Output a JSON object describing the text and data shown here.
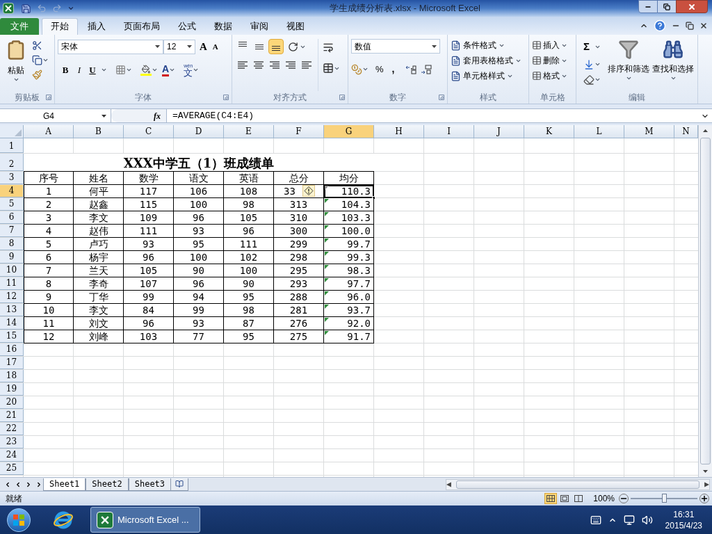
{
  "window": {
    "title": "学生成绩分析表.xlsx - Microsoft Excel"
  },
  "ribbon_tabs": [
    {
      "label": "文件",
      "kind": "file",
      "selected": false
    },
    {
      "label": "开始",
      "kind": "tab",
      "selected": true
    },
    {
      "label": "插入",
      "kind": "tab",
      "selected": false
    },
    {
      "label": "页面布局",
      "kind": "tab",
      "selected": false
    },
    {
      "label": "公式",
      "kind": "tab",
      "selected": false
    },
    {
      "label": "数据",
      "kind": "tab",
      "selected": false
    },
    {
      "label": "审阅",
      "kind": "tab",
      "selected": false
    },
    {
      "label": "视图",
      "kind": "tab",
      "selected": false
    }
  ],
  "ribbon": {
    "clipboard": {
      "label": "剪贴板",
      "paste": "粘贴"
    },
    "font": {
      "label": "字体",
      "name": "宋体",
      "size": "12",
      "grow": "A",
      "shrink": "A",
      "bold": "B",
      "italic": "I",
      "underline": "U",
      "font_color": "A",
      "phonetic_hint": "wén",
      "phonetic": "文"
    },
    "alignment": {
      "label": "对齐方式",
      "vertical": [
        {
          "selected": false
        },
        {
          "selected": false
        },
        {
          "selected": true
        }
      ]
    },
    "number": {
      "label": "数字",
      "format": "数值",
      "percent": "%",
      "comma": ","
    },
    "styles": {
      "label": "样式",
      "items": [
        "条件格式",
        "套用表格格式",
        "单元格样式"
      ]
    },
    "cells": {
      "label": "单元格",
      "items": [
        "插入",
        "删除",
        "格式"
      ]
    },
    "editing": {
      "label": "编辑",
      "sum": "Σ",
      "sort": "排序和筛选",
      "find": "查找和选择"
    }
  },
  "formula_bar": {
    "name_box": "G4",
    "fx": "fx",
    "formula": "=AVERAGE(C4:E4)"
  },
  "columns": [
    {
      "label": "A",
      "selected": false
    },
    {
      "label": "B",
      "selected": false
    },
    {
      "label": "C",
      "selected": false
    },
    {
      "label": "D",
      "selected": false
    },
    {
      "label": "E",
      "selected": false
    },
    {
      "label": "F",
      "selected": false
    },
    {
      "label": "G",
      "selected": true
    },
    {
      "label": "H",
      "selected": false
    },
    {
      "label": "I",
      "selected": false
    },
    {
      "label": "J",
      "selected": false
    },
    {
      "label": "K",
      "selected": false
    },
    {
      "label": "L",
      "selected": false
    },
    {
      "label": "M",
      "selected": false
    },
    {
      "label": "N",
      "selected": false
    }
  ],
  "rows": [
    {
      "number": "1",
      "kind": "blank",
      "selected": false
    },
    {
      "number": "2",
      "kind": "title",
      "selected": false,
      "title": "XXX中学五（1）班成绩单"
    },
    {
      "number": "3",
      "kind": "header",
      "selected": false,
      "cells": [
        "序号",
        "姓名",
        "数学",
        "语文",
        "英语",
        "总分",
        "均分"
      ]
    },
    {
      "number": "4",
      "kind": "data",
      "selected": true,
      "flag": true,
      "smart_tag": true,
      "cells": [
        "1",
        "何平",
        "117",
        "106",
        "108",
        "33",
        "110.3"
      ]
    },
    {
      "number": "5",
      "kind": "data",
      "selected": false,
      "flag": true,
      "cells": [
        "2",
        "赵鑫",
        "115",
        "100",
        "98",
        "313",
        "104.3"
      ]
    },
    {
      "number": "6",
      "kind": "data",
      "selected": false,
      "flag": true,
      "cells": [
        "3",
        "李文",
        "109",
        "96",
        "105",
        "310",
        "103.3"
      ]
    },
    {
      "number": "7",
      "kind": "data",
      "selected": false,
      "flag": true,
      "cells": [
        "4",
        "赵伟",
        "111",
        "93",
        "96",
        "300",
        "100.0"
      ]
    },
    {
      "number": "8",
      "kind": "data",
      "selected": false,
      "flag": true,
      "cells": [
        "5",
        "卢巧",
        "93",
        "95",
        "111",
        "299",
        "99.7"
      ]
    },
    {
      "number": "9",
      "kind": "data",
      "selected": false,
      "flag": true,
      "cells": [
        "6",
        "杨宇",
        "96",
        "100",
        "102",
        "298",
        "99.3"
      ]
    },
    {
      "number": "10",
      "kind": "data",
      "selected": false,
      "flag": true,
      "cells": [
        "7",
        "兰天",
        "105",
        "90",
        "100",
        "295",
        "98.3"
      ]
    },
    {
      "number": "11",
      "kind": "data",
      "selected": false,
      "flag": true,
      "cells": [
        "8",
        "李奇",
        "107",
        "96",
        "90",
        "293",
        "97.7"
      ]
    },
    {
      "number": "12",
      "kind": "data",
      "selected": false,
      "flag": true,
      "cells": [
        "9",
        "丁华",
        "99",
        "94",
        "95",
        "288",
        "96.0"
      ]
    },
    {
      "number": "13",
      "kind": "data",
      "selected": false,
      "flag": true,
      "cells": [
        "10",
        "李文",
        "84",
        "99",
        "98",
        "281",
        "93.7"
      ]
    },
    {
      "number": "14",
      "kind": "data",
      "selected": false,
      "flag": true,
      "cells": [
        "11",
        "刘文",
        "96",
        "93",
        "87",
        "276",
        "92.0"
      ]
    },
    {
      "number": "15",
      "kind": "data",
      "selected": false,
      "flag": true,
      "cells": [
        "12",
        "刘峰",
        "103",
        "77",
        "95",
        "275",
        "91.7"
      ]
    },
    {
      "number": "16",
      "kind": "blank",
      "selected": false
    },
    {
      "number": "17",
      "kind": "blank",
      "selected": false
    },
    {
      "number": "18",
      "kind": "blank",
      "selected": false
    },
    {
      "number": "19",
      "kind": "blank",
      "selected": false
    },
    {
      "number": "20",
      "kind": "blank",
      "selected": false
    },
    {
      "number": "21",
      "kind": "blank",
      "selected": false
    },
    {
      "number": "22",
      "kind": "blank",
      "selected": false
    },
    {
      "number": "23",
      "kind": "blank",
      "selected": false
    },
    {
      "number": "24",
      "kind": "blank",
      "selected": false
    },
    {
      "number": "25",
      "kind": "blank",
      "selected": false
    }
  ],
  "sheets": [
    {
      "label": "Sheet1",
      "selected": true
    },
    {
      "label": "Sheet2",
      "selected": false
    },
    {
      "label": "Sheet3",
      "selected": false
    }
  ],
  "status_bar": {
    "text": "就绪",
    "views": [
      {
        "selected": true
      },
      {
        "selected": false
      },
      {
        "selected": false
      }
    ],
    "zoom": "100%",
    "zoom_slider": {
      "level": 0.5
    }
  },
  "taskbar": {
    "app": "Microsoft Excel ...",
    "time": "16:31",
    "date": "2015/4/23"
  }
}
